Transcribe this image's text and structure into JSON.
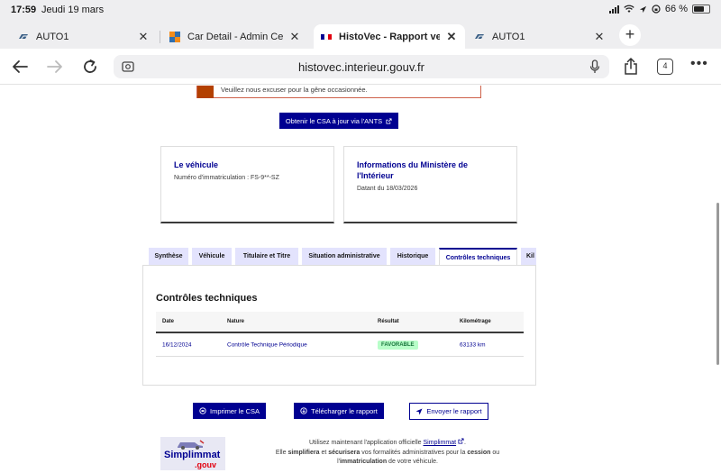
{
  "status_bar": {
    "time": "17:59",
    "date": "Jeudi 19 mars",
    "battery": "66 %"
  },
  "browser_tabs": [
    {
      "label": "AUTO1",
      "favicon": "auto1-icon",
      "active": false
    },
    {
      "label": "Car Detail - Admin Cent",
      "favicon": "admin-center-icon",
      "active": false
    },
    {
      "label": "HistoVec - Rapport vend",
      "favicon": "french-flag-icon",
      "active": true
    },
    {
      "label": "AUTO1",
      "favicon": "auto1-icon",
      "active": false
    }
  ],
  "toolbar": {
    "url": "histovec.interieur.gouv.fr",
    "tab_count": "4"
  },
  "notice": {
    "text": "Veuillez nous excuser pour la gêne occasionnée."
  },
  "csa_button": {
    "label": "Obtenir le CSA à jour via l'ANTS"
  },
  "cards": {
    "vehicle": {
      "title": "Le véhicule",
      "subtitle": "Numéro d'immatriculation : FS-9**-SZ"
    },
    "ministry": {
      "title": "Informations du Ministère de l'Intérieur",
      "subtitle": "Datant du 18/03/2026"
    }
  },
  "report_tabs": [
    {
      "label": "Synthèse",
      "selected": false
    },
    {
      "label": "Véhicule",
      "selected": false
    },
    {
      "label": "Titulaire et Titre",
      "selected": false
    },
    {
      "label": "Situation administrative",
      "selected": false
    },
    {
      "label": "Historique",
      "selected": false
    },
    {
      "label": "Contrôles techniques",
      "selected": true
    },
    {
      "label": "Kil",
      "selected": false
    }
  ],
  "inspections": {
    "title": "Contrôles techniques",
    "headers": {
      "date": "Date",
      "nature": "Nature",
      "result": "Résultat",
      "mileage": "Kilométrage"
    },
    "rows": [
      {
        "date": "16/12/2024",
        "nature": "Contrôle Technique Périodique",
        "result": "FAVORABLE",
        "mileage": "63133 km"
      }
    ]
  },
  "actions": {
    "print": "Imprimer le CSA",
    "download": "Télécharger le rapport",
    "send": "Envoyer le rapport"
  },
  "footer": {
    "logo_name": "Simplimmat",
    "logo_suffix": ".gouv",
    "line1_prefix": "Utilisez maintenant l'application officielle",
    "app_link": "Simplimmat",
    "line2_prefix": "Elle",
    "simplify": "simplifiera",
    "and": "et",
    "secure": "sécurisera",
    "line2_suffix": "vos formalités administratives pour la",
    "transfer": "cession",
    "or": "ou",
    "the": "l'",
    "registration": "immatriculation",
    "end": "de votre véhicule."
  },
  "colors": {
    "primary": "#000091",
    "tab_bg": "#e3e3fd",
    "notice_bar": "#b34000",
    "success_bg": "#b8fec9",
    "success_text": "#18753c"
  }
}
